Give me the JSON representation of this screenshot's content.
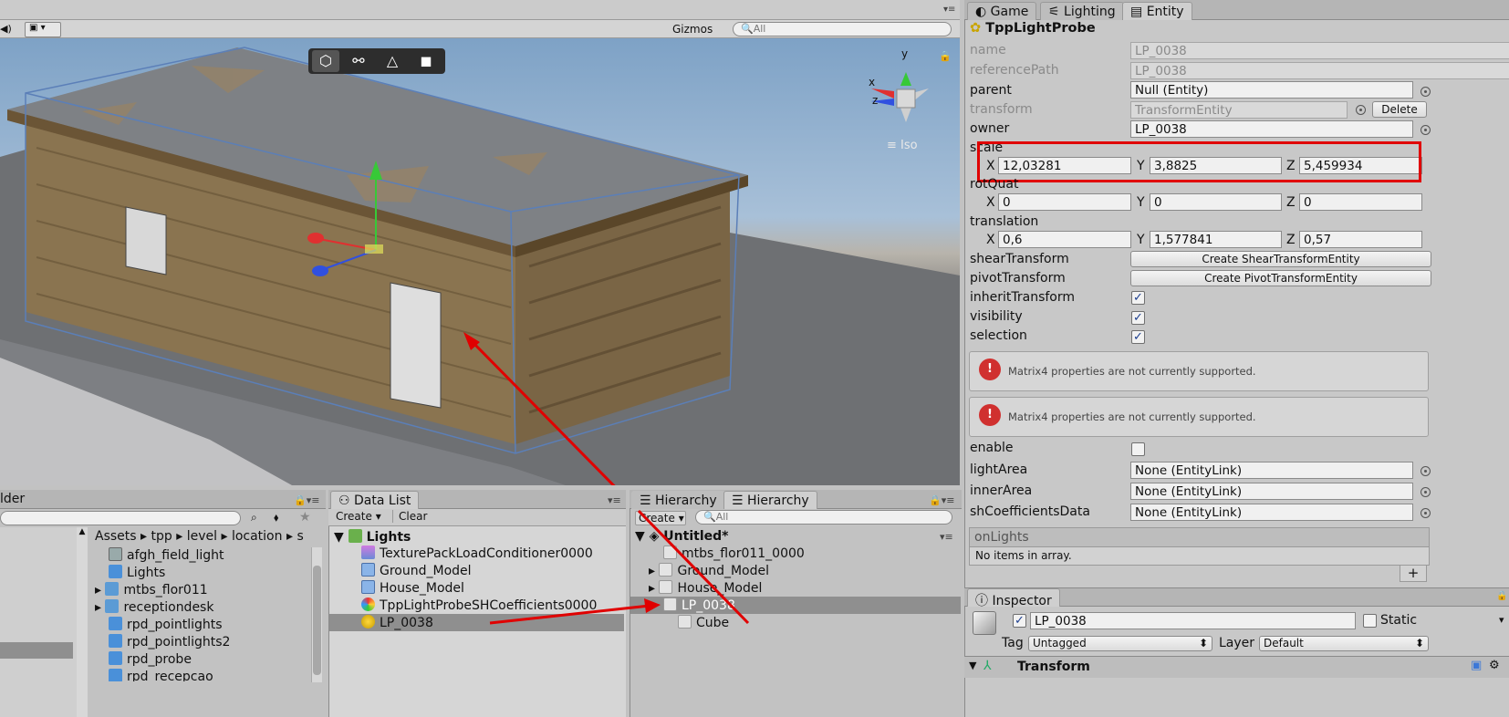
{
  "scene": {
    "gizmos_label": "Gizmos",
    "search_placeholder": "All",
    "iso_label": "Iso",
    "axis_x": "x",
    "axis_y": "y",
    "axis_z": "z"
  },
  "right_tabs": {
    "game": "Game",
    "lighting": "Lighting",
    "entity": "Entity"
  },
  "entity": {
    "component": "TppLightProbe",
    "rows": {
      "name_label": "name",
      "name_value": "LP_0038",
      "refpath_label": "referencePath",
      "refpath_value": "LP_0038",
      "parent_label": "parent",
      "parent_value": "Null (Entity)",
      "transform_label": "transform",
      "transform_value": "TransformEntity",
      "delete_label": "Delete",
      "owner_label": "owner",
      "owner_value": "LP_0038",
      "scale_label": "scale",
      "scale_x": "12,03281",
      "scale_y": "3,8825",
      "scale_z": "5,459934",
      "rot_label": "rotQuat",
      "rot_x": "0",
      "rot_y": "0",
      "rot_z": "0",
      "trans_label": "translation",
      "trans_x": "0,6",
      "trans_y": "1,577841",
      "trans_z": "0,57",
      "shear_label": "shearTransform",
      "shear_button": "Create ShearTransformEntity",
      "pivot_label": "pivotTransform",
      "pivot_button": "Create PivotTransformEntity",
      "inherit_label": "inheritTransform",
      "visibility_label": "visibility",
      "selection_label": "selection",
      "matrix_msg": "Matrix4 properties are not currently supported.",
      "enable_label": "enable",
      "lightarea_label": "lightArea",
      "lightarea_value": "None (EntityLink)",
      "innerarea_label": "innerArea",
      "innerarea_value": "None (EntityLink)",
      "shcoef_label": "shCoefficientsData",
      "shcoef_value": "None (EntityLink)",
      "onlights_label": "onLights",
      "no_items": "No items in array.",
      "plus": "+",
      "axis_x": "X",
      "axis_y": "Y",
      "axis_z": "Z"
    }
  },
  "inspector": {
    "tab": "Inspector",
    "object_name": "LP_0038",
    "static_label": "Static",
    "tag_label": "Tag",
    "tag_value": "Untagged",
    "layer_label": "Layer",
    "layer_value": "Default",
    "transform_header": "Transform"
  },
  "project": {
    "tab": "lder",
    "breadcrumb": [
      "Assets",
      "tpp",
      "level",
      "location",
      "s"
    ],
    "items": [
      "afgh_field_light",
      "Lights",
      "mtbs_flor011",
      "receptiondesk",
      "rpd_pointlights",
      "rpd_pointlights2",
      "rpd_probe",
      "rpd_recepcao"
    ]
  },
  "datalist": {
    "tab": "Data List",
    "create": "Create",
    "clear": "Clear",
    "root": "Lights",
    "items": [
      "TexturePackLoadConditioner0000",
      "Ground_Model",
      "House_Model",
      "TppLightProbeSHCoefficients0000",
      "LP_0038"
    ]
  },
  "hierarchy": {
    "tab1": "Hierarchy",
    "tab2": "Hierarchy",
    "create": "Create",
    "search_placeholder": "All",
    "scene": "Untitled*",
    "items": [
      "mtbs_flor011_0000",
      "Ground_Model",
      "House_Model",
      "LP_0038",
      "Cube"
    ]
  },
  "colors": {
    "highlight": "#e00000",
    "selection": "#8f8f8f",
    "accent": "#3c78d8"
  }
}
